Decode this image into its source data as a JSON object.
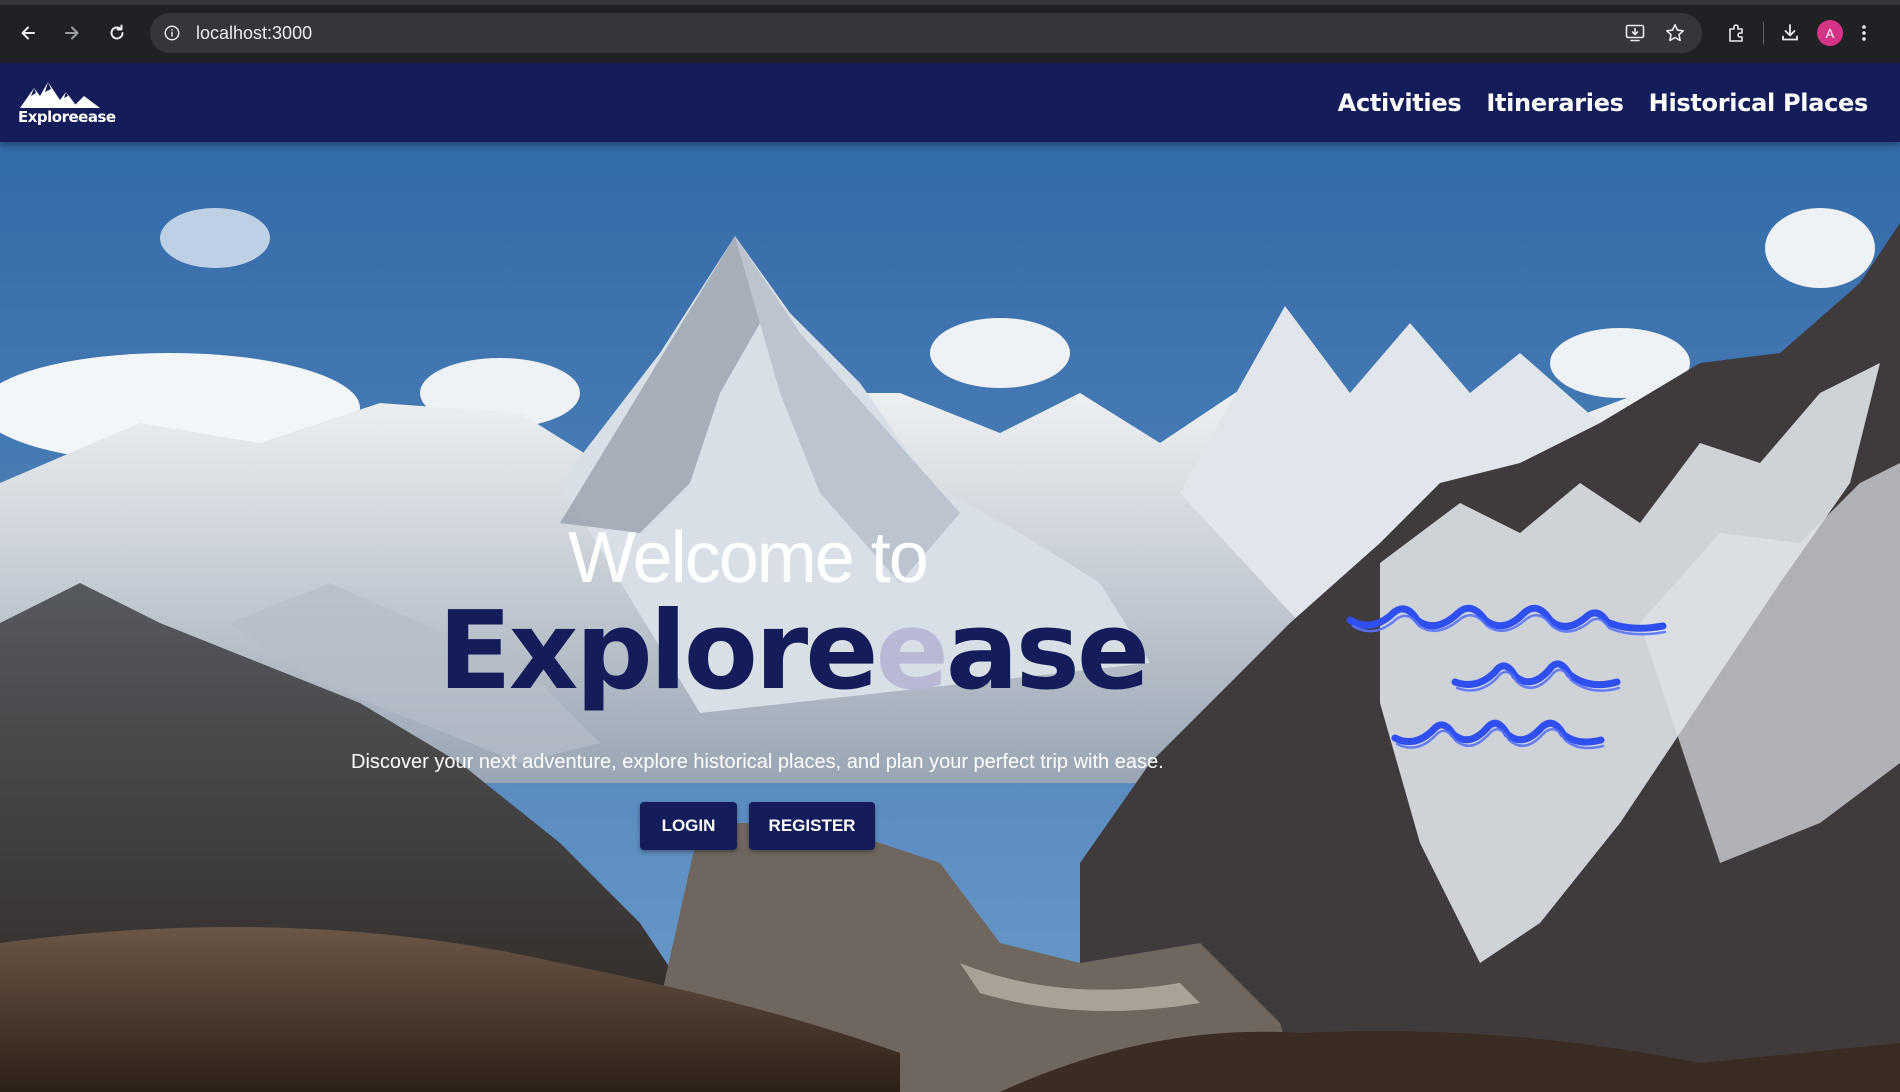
{
  "browser": {
    "url": "localhost:3000",
    "profile_initial": "A",
    "icons": {
      "back": "back-arrow-icon",
      "forward": "forward-arrow-icon",
      "reload": "reload-icon",
      "site_info": "site-info-icon",
      "install": "install-app-icon",
      "bookmark": "bookmark-star-icon",
      "extensions": "extensions-puzzle-icon",
      "downloads": "download-icon",
      "menu": "kebab-menu-icon"
    },
    "colors": {
      "frame": "#202124",
      "omnibox": "#35363a",
      "avatar": "#d63384"
    }
  },
  "header": {
    "logo_text": "Exploreease",
    "logo_icon": "mountain-logo-icon",
    "nav": [
      {
        "label": "Activities"
      },
      {
        "label": "Itineraries"
      },
      {
        "label": "Historical Places"
      }
    ],
    "background_color": "#141c5a"
  },
  "hero": {
    "welcome": "Welcome to",
    "brand_part1": "Explore",
    "brand_accent": "e",
    "brand_part2": "ase",
    "tagline": "Discover your next adventure, explore historical places, and plan your perfect trip with ease.",
    "login_label": "LOGIN",
    "register_label": "REGISTER",
    "background_image": "snowy-mountain-valley",
    "decoration_icon": "blue-waves-icon",
    "colors": {
      "brand": "#141c5a",
      "brand_accent": "#b9b9d6",
      "waves": "#2f4ff0"
    }
  }
}
